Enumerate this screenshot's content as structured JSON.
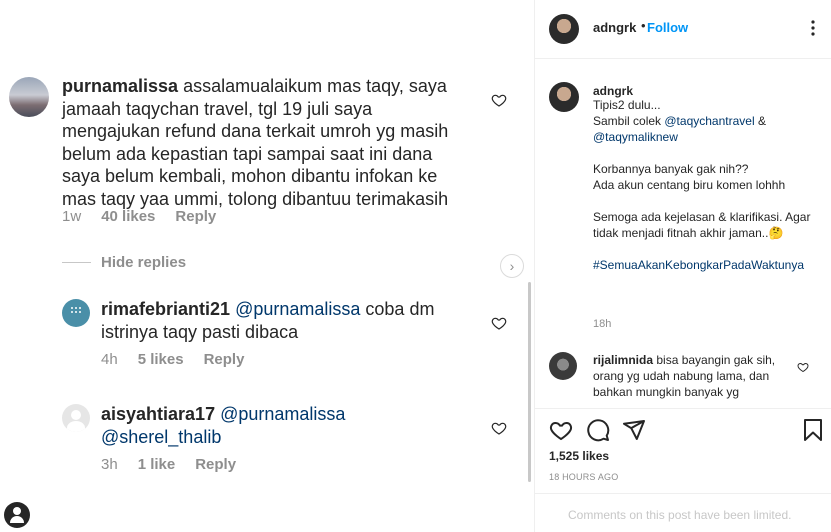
{
  "left": {
    "comments": [
      {
        "username": "purnamalissa",
        "text": " assalamualaikum mas taqy, saya jamaah taqychan travel, tgl 19 juli saya mengajukan refund dana terkait umroh yg masih belum ada kepastian tapi sampai saat ini dana saya belum kembali, mohon dibantu infokan ke mas taqy yaa ummi, tolong dibantuu terimakasih",
        "age": "1w",
        "likes": "40 likes",
        "reply": "Reply"
      }
    ],
    "hide_replies": "Hide replies",
    "replies": [
      {
        "username": "rimafebrianti21",
        "mention": "@purnamalissa",
        "text": " coba dm istrinya taqy pasti dibaca",
        "age": "4h",
        "likes": "5 likes",
        "reply": "Reply"
      },
      {
        "username": "aisyahtiara17",
        "mention": "@purnamalissa",
        "mention2": "@sherel_thalib",
        "age": "3h",
        "likes": "1 like",
        "reply": "Reply"
      }
    ]
  },
  "right": {
    "header": {
      "username": "adngrk",
      "dot": "•",
      "follow": "Follow"
    },
    "caption": {
      "username": "adngrk",
      "line1": "Tipis2 dulu...",
      "line2a": "Sambil colek ",
      "tag1": "@taqychantravel",
      "line2b": " & ",
      "tag2": "@taqymaliknew",
      "para2": "Korbannya banyak gak nih??\nAda akun centang biru komen lohhh",
      "para3": "Semoga ada kejelasan & klarifikasi. Agar tidak menjadi fitnah akhir jaman..",
      "emoji": "🤔",
      "hashtag": "#SemuaAkanKebongkarPadaWaktunya",
      "time": "18h"
    },
    "comment": {
      "username": "rijalimnida",
      "text": " bisa bayangin gak sih, orang yg udah nabung lama, dan bahkan mungkin banyak yg"
    },
    "likes": "1,525 likes",
    "posttime": "18 HOURS AGO",
    "limited": "Comments on this post have been limited."
  },
  "colors": {
    "link": "#00376b",
    "follow": "#0095f6",
    "muted": "#8e8e8e"
  }
}
